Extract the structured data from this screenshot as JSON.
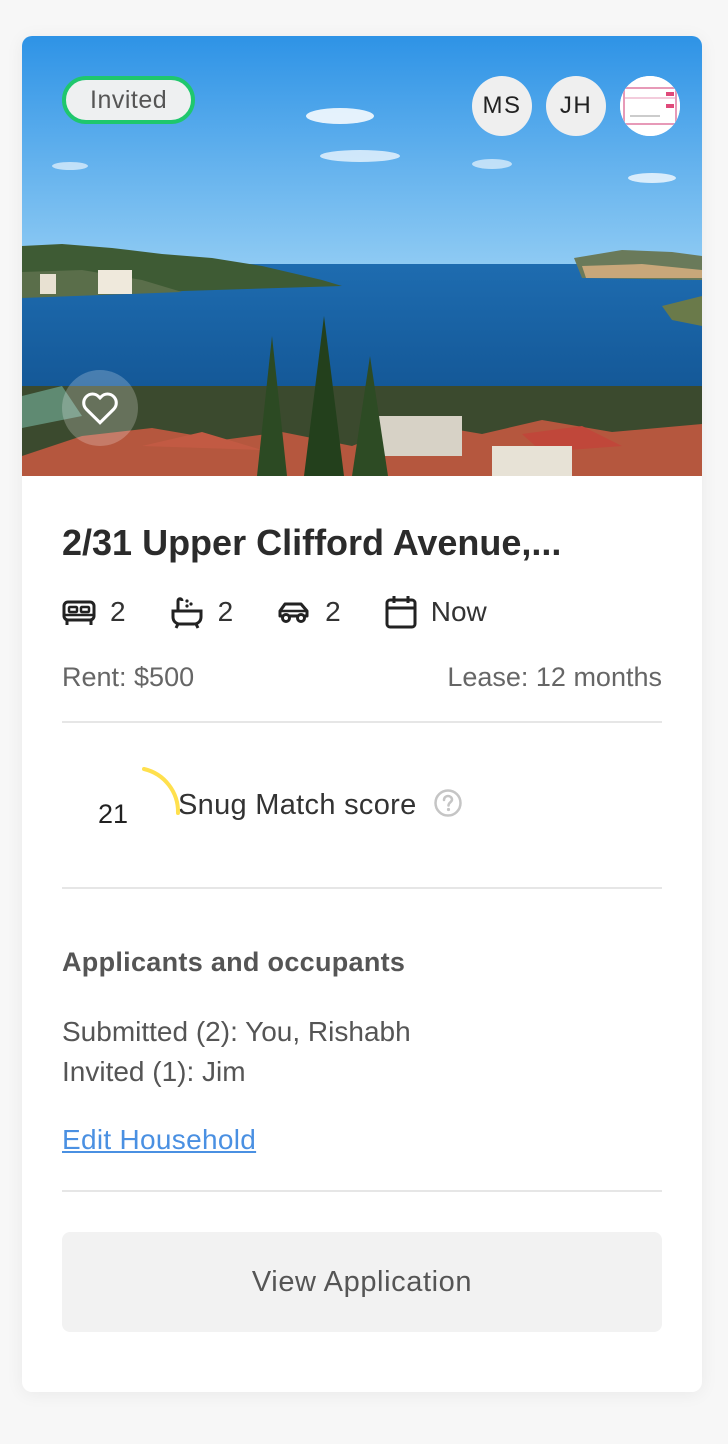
{
  "card": {
    "status_badge": "Invited",
    "avatars": [
      {
        "initials": "MS"
      },
      {
        "initials": "JH"
      },
      {
        "initials": ""
      }
    ],
    "title": "2/31 Upper Clifford Avenue,...",
    "features": {
      "bedrooms": "2",
      "bathrooms": "2",
      "parking": "2",
      "available": "Now"
    },
    "rent": "Rent: $500",
    "lease": "Lease: 12 months",
    "match": {
      "score": "21",
      "label": "Snug Match score"
    },
    "applicants": {
      "heading": "Applicants and occupants",
      "submitted": "Submitted (2): You, Rishabh",
      "invited": "Invited (1): Jim",
      "edit_link": "Edit Household"
    },
    "view_button": "View Application"
  },
  "colors": {
    "badge_border": "#1fc76d",
    "link": "#4a90e2",
    "gauge": "#ffe04d"
  },
  "icons": [
    "bed-icon",
    "bath-icon",
    "car-icon",
    "calendar-icon",
    "heart-icon",
    "help-icon"
  ]
}
